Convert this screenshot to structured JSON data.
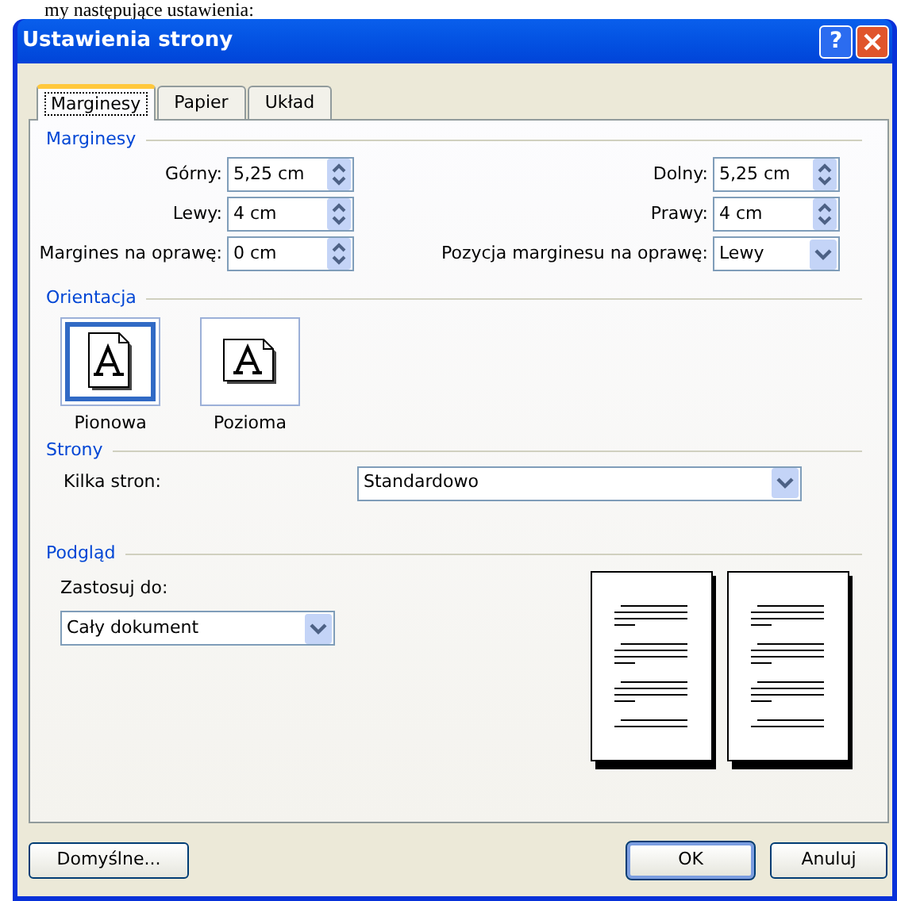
{
  "document_text": "my następujące ustawienia:",
  "window": {
    "title": "Ustawienia strony",
    "help_button": "?"
  },
  "tabs": [
    {
      "label": "Marginesy",
      "selected": true
    },
    {
      "label": "Papier",
      "selected": false
    },
    {
      "label": "Układ",
      "selected": false
    }
  ],
  "margins": {
    "heading": "Marginesy",
    "fields": [
      {
        "label": "Górny:",
        "value": "5,25 cm",
        "kind": "spin"
      },
      {
        "label": "Dolny:",
        "value": "5,25 cm",
        "kind": "spin"
      },
      {
        "label": "Lewy:",
        "value": "4 cm",
        "kind": "spin"
      },
      {
        "label": "Prawy:",
        "value": "4 cm",
        "kind": "spin"
      },
      {
        "label": "Margines na oprawę:",
        "value": "0 cm",
        "kind": "spin"
      },
      {
        "label": "Pozycja marginesu na oprawę:",
        "value": "Lewy",
        "kind": "dropdown"
      }
    ]
  },
  "orientation": {
    "heading": "Orientacja",
    "options": [
      {
        "label": "Pionowa",
        "kind": "portrait",
        "selected": true
      },
      {
        "label": "Pozioma",
        "kind": "landscape",
        "selected": false
      }
    ]
  },
  "pages": {
    "heading": "Strony",
    "label": "Kilka stron:",
    "value": "Standardowo"
  },
  "preview": {
    "heading": "Podgląd",
    "apply_label": "Zastosuj do:",
    "apply_value": "Cały dokument"
  },
  "buttons": [
    {
      "label": "Domyślne...",
      "default": false
    },
    {
      "label": "OK",
      "default": true
    },
    {
      "label": "Anuluj",
      "default": false
    }
  ]
}
